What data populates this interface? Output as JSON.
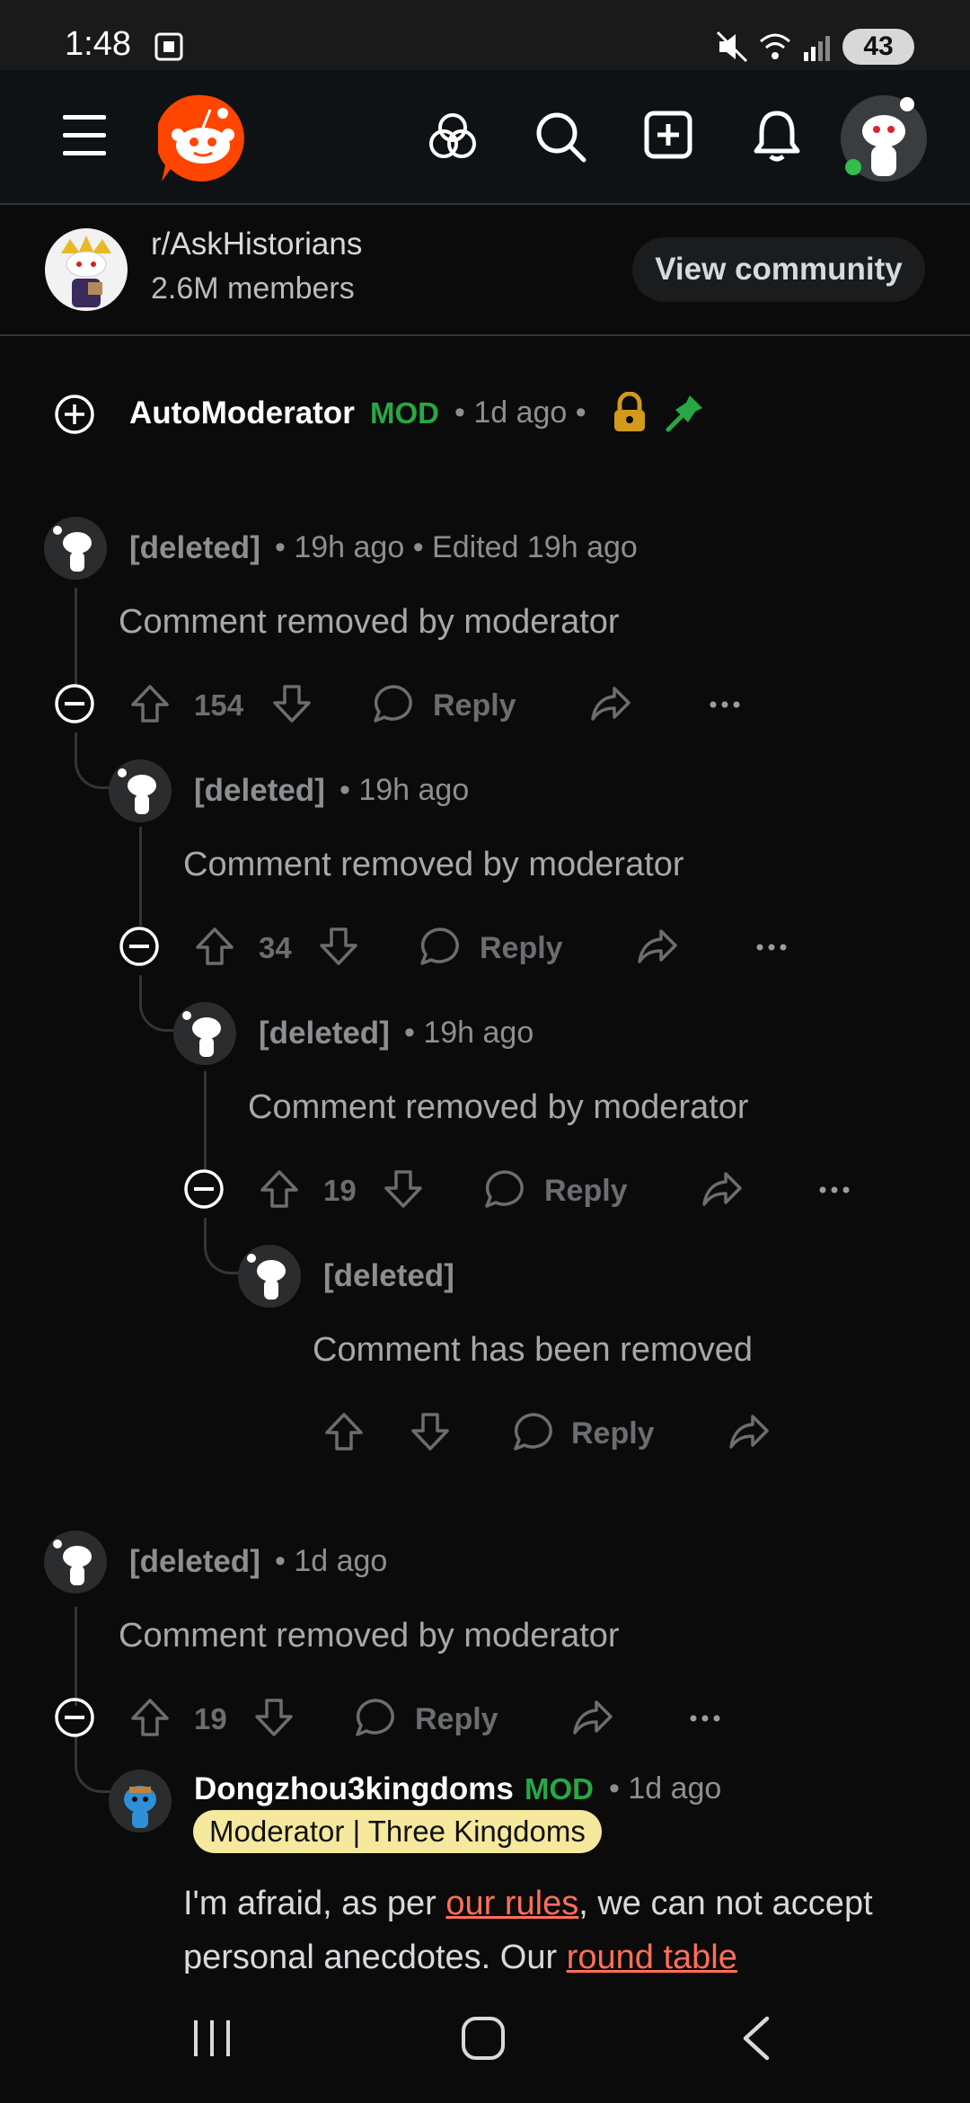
{
  "status_bar": {
    "time": "1:48",
    "battery": "43"
  },
  "community": {
    "name": "r/AskHistorians",
    "members": "2.6M members",
    "view_button": "View community"
  },
  "automod": {
    "author": "AutoModerator",
    "badge": "MOD",
    "time": "• 1d ago •"
  },
  "comments": [
    {
      "author": "[deleted]",
      "meta": "• 19h ago • Edited 19h ago",
      "body": "Comment removed by moderator",
      "votes": "154",
      "reply": "Reply"
    },
    {
      "author": "[deleted]",
      "meta": "• 19h ago",
      "body": "Comment removed by moderator",
      "votes": "34",
      "reply": "Reply"
    },
    {
      "author": "[deleted]",
      "meta": "• 19h ago",
      "body": "Comment removed by moderator",
      "votes": "19",
      "reply": "Reply"
    },
    {
      "author": "[deleted]",
      "meta": "",
      "body": "Comment has been removed",
      "votes": "",
      "reply": "Reply"
    },
    {
      "author": "[deleted]",
      "meta": "• 1d ago",
      "body": "Comment removed by moderator",
      "votes": "19",
      "reply": "Reply"
    }
  ],
  "mod_comment": {
    "author": "Dongzhou3kingdoms",
    "badge": "MOD",
    "time": "• 1d ago",
    "flair": "Moderator | Three Kingdoms",
    "text_1": "I'm afraid, as per ",
    "link_1": "our rules",
    "text_2": ", we can not accept personal anecdotes. Our ",
    "link_2": "round table"
  },
  "icons": {
    "menu": "menu-icon",
    "logo": "reddit-logo",
    "popular": "popular-icon",
    "search": "search-icon",
    "create": "create-post-icon",
    "notifications": "bell-icon",
    "avatar": "user-avatar",
    "lock": "lock-icon",
    "pin": "pin-icon"
  },
  "colors": {
    "mod_green": "#27a844",
    "link": "#ff6f5a",
    "flair_bg": "#f6e89c",
    "logo": "#ff4500"
  }
}
